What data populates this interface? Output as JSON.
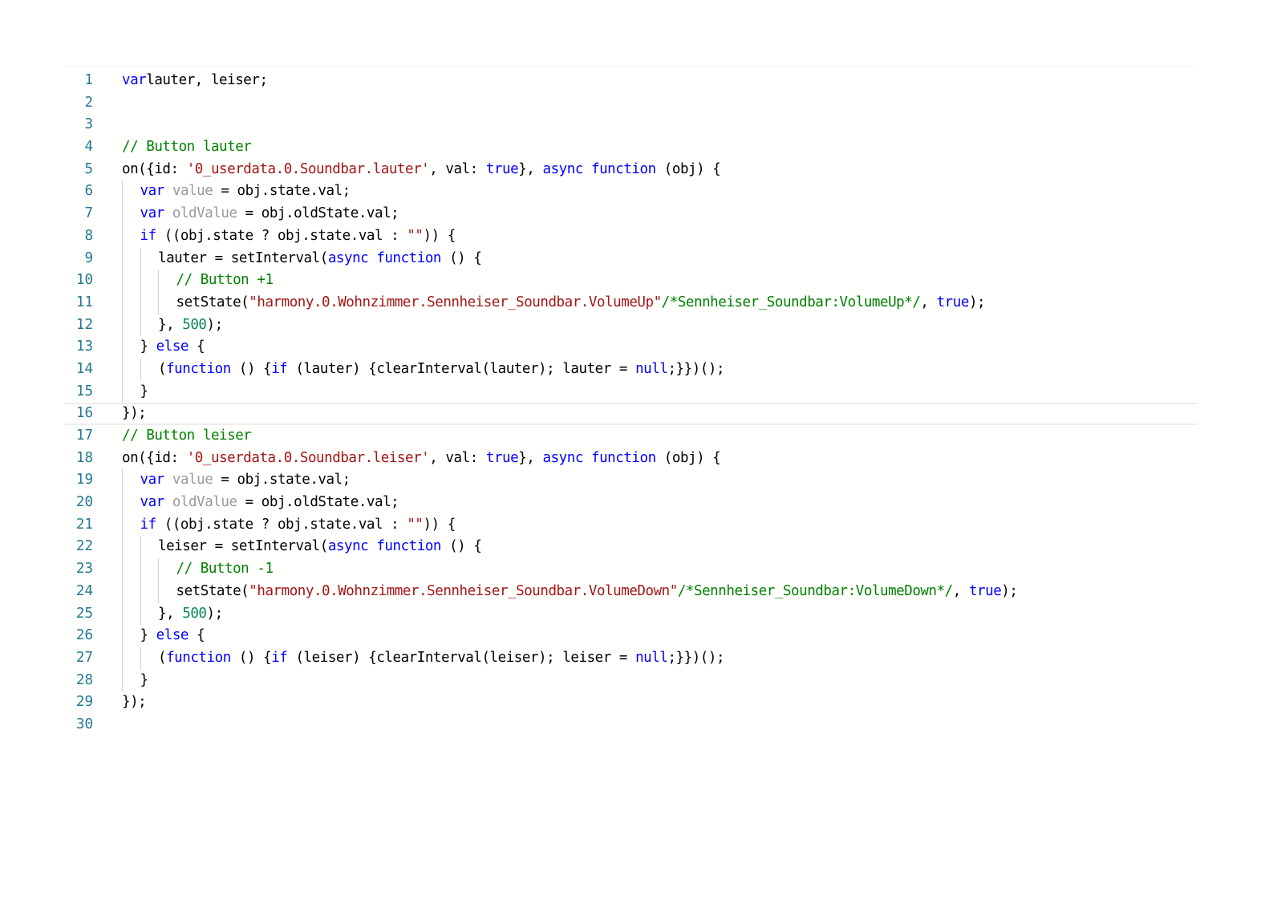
{
  "editor": {
    "lines": [
      {
        "n": "1",
        "indent": 0,
        "tokens": [
          [
            "kw",
            "var"
          ],
          [
            "",
            "lauter, leiser;"
          ]
        ]
      },
      {
        "n": "2",
        "indent": 0,
        "tokens": []
      },
      {
        "n": "3",
        "indent": 0,
        "tokens": []
      },
      {
        "n": "4",
        "indent": 0,
        "tokens": [
          [
            "cm",
            "// Button lauter"
          ]
        ]
      },
      {
        "n": "5",
        "indent": 0,
        "tokens": [
          [
            "",
            "on({id: "
          ],
          [
            "str",
            "'0_userdata.0.Soundbar.lauter'"
          ],
          [
            "",
            ", val: "
          ],
          [
            "kw",
            "true"
          ],
          [
            "",
            "}, "
          ],
          [
            "kw",
            "async function"
          ],
          [
            "",
            " (obj) {"
          ]
        ]
      },
      {
        "n": "6",
        "indent": 1,
        "tokens": [
          [
            "kw",
            "var"
          ],
          [
            "",
            " "
          ],
          [
            "unused",
            "value"
          ],
          [
            "",
            " = obj.state.val;"
          ]
        ]
      },
      {
        "n": "7",
        "indent": 1,
        "tokens": [
          [
            "kw",
            "var"
          ],
          [
            "",
            " "
          ],
          [
            "unused",
            "oldValue"
          ],
          [
            "",
            " = obj.oldState.val;"
          ]
        ]
      },
      {
        "n": "8",
        "indent": 1,
        "tokens": [
          [
            "kw",
            "if"
          ],
          [
            "",
            " ((obj.state ? obj.state.val : "
          ],
          [
            "str",
            "\"\""
          ],
          [
            "",
            ")) {"
          ]
        ]
      },
      {
        "n": "9",
        "indent": 2,
        "tokens": [
          [
            "",
            "lauter = setInterval("
          ],
          [
            "kw",
            "async function"
          ],
          [
            "",
            " () {"
          ]
        ]
      },
      {
        "n": "10",
        "indent": 3,
        "tokens": [
          [
            "cm",
            "// Button +1"
          ]
        ]
      },
      {
        "n": "11",
        "indent": 3,
        "tokens": [
          [
            "",
            "setState("
          ],
          [
            "str",
            "\"harmony.0.Wohnzimmer.Sennheiser_Soundbar.VolumeUp\""
          ],
          [
            "cm",
            "/*Sennheiser_Soundbar:VolumeUp*/"
          ],
          [
            "",
            ", "
          ],
          [
            "kw",
            "true"
          ],
          [
            "",
            ");"
          ]
        ]
      },
      {
        "n": "12",
        "indent": 2,
        "tokens": [
          [
            "",
            "}, "
          ],
          [
            "num",
            "500"
          ],
          [
            "",
            ");"
          ]
        ]
      },
      {
        "n": "13",
        "indent": 1,
        "tokens": [
          [
            "",
            "} "
          ],
          [
            "kw",
            "else"
          ],
          [
            "",
            " {"
          ]
        ]
      },
      {
        "n": "14",
        "indent": 2,
        "tokens": [
          [
            "",
            "("
          ],
          [
            "kw",
            "function"
          ],
          [
            "",
            " () {"
          ],
          [
            "kw",
            "if"
          ],
          [
            "",
            " (lauter) {clearInterval(lauter); lauter = "
          ],
          [
            "kw",
            "null"
          ],
          [
            "",
            ";}})();"
          ]
        ]
      },
      {
        "n": "15",
        "indent": 1,
        "tokens": [
          [
            "",
            "}"
          ]
        ]
      },
      {
        "n": "16",
        "indent": 0,
        "tokens": [
          [
            "",
            "});"
          ]
        ]
      },
      {
        "n": "17",
        "indent": 0,
        "tokens": [
          [
            "cm",
            "// Button leiser"
          ]
        ]
      },
      {
        "n": "18",
        "indent": 0,
        "tokens": [
          [
            "",
            "on({id: "
          ],
          [
            "str",
            "'0_userdata.0.Soundbar.leiser'"
          ],
          [
            "",
            ", val: "
          ],
          [
            "kw",
            "true"
          ],
          [
            "",
            "}, "
          ],
          [
            "kw",
            "async function"
          ],
          [
            "",
            " (obj) {"
          ]
        ]
      },
      {
        "n": "19",
        "indent": 1,
        "tokens": [
          [
            "kw",
            "var"
          ],
          [
            "",
            " "
          ],
          [
            "unused",
            "value"
          ],
          [
            "",
            " = obj.state.val;"
          ]
        ]
      },
      {
        "n": "20",
        "indent": 1,
        "tokens": [
          [
            "kw",
            "var"
          ],
          [
            "",
            " "
          ],
          [
            "unused",
            "oldValue"
          ],
          [
            "",
            " = obj.oldState.val;"
          ]
        ]
      },
      {
        "n": "21",
        "indent": 1,
        "tokens": [
          [
            "kw",
            "if"
          ],
          [
            "",
            " ((obj.state ? obj.state.val : "
          ],
          [
            "str",
            "\"\""
          ],
          [
            "",
            ")) {"
          ]
        ]
      },
      {
        "n": "22",
        "indent": 2,
        "tokens": [
          [
            "",
            "leiser = setInterval("
          ],
          [
            "kw",
            "async function"
          ],
          [
            "",
            " () {"
          ]
        ]
      },
      {
        "n": "23",
        "indent": 3,
        "tokens": [
          [
            "cm",
            "// Button -1"
          ]
        ]
      },
      {
        "n": "24",
        "indent": 3,
        "tokens": [
          [
            "",
            "setState("
          ],
          [
            "str",
            "\"harmony.0.Wohnzimmer.Sennheiser_Soundbar.VolumeDown\""
          ],
          [
            "cm",
            "/*Sennheiser_Soundbar:VolumeDown*/"
          ],
          [
            "",
            ", "
          ],
          [
            "kw",
            "true"
          ],
          [
            "",
            ");"
          ]
        ]
      },
      {
        "n": "25",
        "indent": 2,
        "tokens": [
          [
            "",
            "}, "
          ],
          [
            "num",
            "500"
          ],
          [
            "",
            ");"
          ]
        ]
      },
      {
        "n": "26",
        "indent": 1,
        "tokens": [
          [
            "",
            "} "
          ],
          [
            "kw",
            "else"
          ],
          [
            "",
            " {"
          ]
        ]
      },
      {
        "n": "27",
        "indent": 2,
        "tokens": [
          [
            "",
            "("
          ],
          [
            "kw",
            "function"
          ],
          [
            "",
            " () {"
          ],
          [
            "kw",
            "if"
          ],
          [
            "",
            " (leiser) {clearInterval(leiser); leiser = "
          ],
          [
            "kw",
            "null"
          ],
          [
            "",
            ";}})();"
          ]
        ]
      },
      {
        "n": "28",
        "indent": 1,
        "tokens": [
          [
            "",
            "}"
          ]
        ]
      },
      {
        "n": "29",
        "indent": 0,
        "tokens": [
          [
            "",
            "});"
          ]
        ]
      },
      {
        "n": "30",
        "indent": 0,
        "tokens": []
      }
    ],
    "highlighted_line": "16",
    "colors": {
      "keyword": "#0000ff",
      "string": "#a31515",
      "comment": "#008000",
      "number": "#098658",
      "unused": "#999999",
      "line_number": "#237893"
    }
  }
}
